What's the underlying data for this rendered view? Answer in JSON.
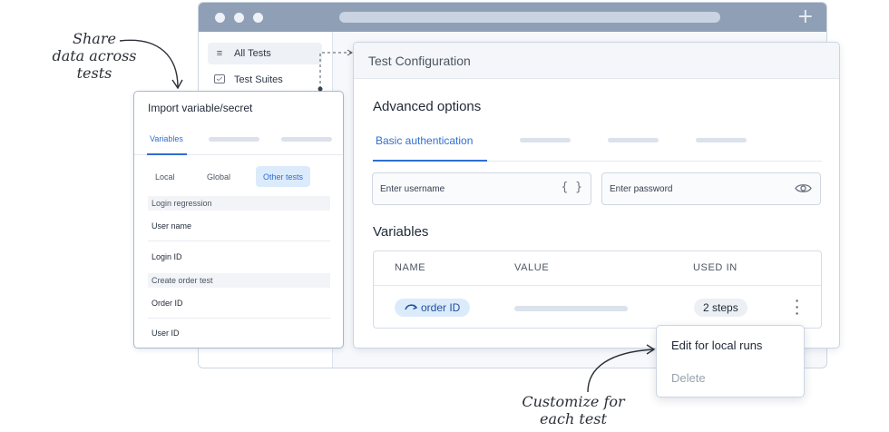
{
  "browser": {
    "sidebar": [
      {
        "label": "All Tests",
        "icon": "list-icon"
      },
      {
        "label": "Test Suites",
        "icon": "folder-icon"
      }
    ],
    "new_tab_icon": "+"
  },
  "annotations": {
    "share": [
      "Share",
      "data across",
      "tests"
    ],
    "customize": [
      "Customize for",
      "each test"
    ]
  },
  "import_panel": {
    "title": "Import variable/secret",
    "active_tab": "Variables",
    "scopes": [
      "Local",
      "Global",
      "Other tests"
    ],
    "active_scope": "Other tests",
    "groups": [
      {
        "name": "Login regression",
        "items": [
          "User name",
          "Login ID"
        ]
      },
      {
        "name": "Create order test",
        "items": [
          "Order ID",
          "User ID"
        ]
      }
    ]
  },
  "config_panel": {
    "title": "Test Configuration",
    "advanced_heading": "Advanced options",
    "active_tab": "Basic authentication",
    "username_placeholder": "Enter username",
    "username_icon": "{ }",
    "password_placeholder": "Enter password",
    "variables_heading": "Variables",
    "columns": [
      "NAME",
      "VALUE",
      "USED IN"
    ],
    "row": {
      "name": "order ID",
      "used_in": "2 steps"
    }
  },
  "context_menu": {
    "items": [
      "Edit for local runs",
      "Delete"
    ]
  },
  "colors": {
    "accent": "#2f6fd1",
    "chip_bg": "#dcebfb",
    "browser_bar": "#8f9fb6"
  }
}
